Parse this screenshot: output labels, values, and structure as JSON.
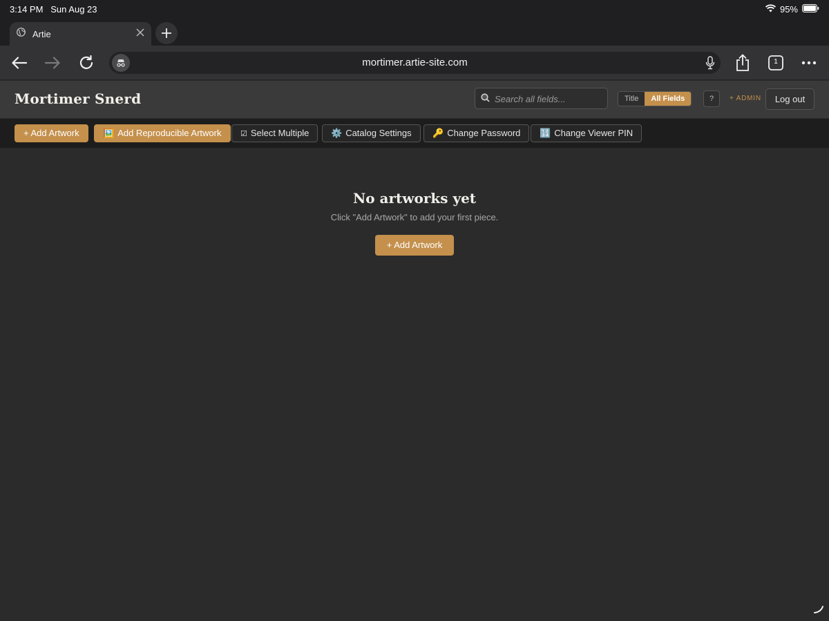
{
  "status": {
    "time": "3:14 PM",
    "date": "Sun Aug 23",
    "battery": "95%"
  },
  "browser": {
    "tab_title": "Artie",
    "url": "mortimer.artie-site.com",
    "tab_count": "1",
    "accent": "#c4904c"
  },
  "header": {
    "site_title": "Mortimer Snerd",
    "search_placeholder": "Search all fields...",
    "scope_options": [
      "Title",
      "All Fields"
    ],
    "scope_selected": "All Fields",
    "help_label": "?",
    "admin_label": "+ ADMIN",
    "logout_label": "Log out"
  },
  "actions": {
    "add_artwork": "+ Add Artwork",
    "add_reproducible": "Add Reproducible Artwork",
    "select_multiple": "Select Multiple",
    "catalog_settings": "Catalog Settings",
    "change_password": "Change Password",
    "change_viewer_pin": "Change Viewer PIN"
  },
  "icons": {
    "add_reproducible": "🖼️",
    "select_multiple": "☑",
    "catalog_settings": "⚙️",
    "change_password": "🔑",
    "change_viewer_pin": "🔢"
  },
  "empty_state": {
    "title": "No artworks yet",
    "subtitle": "Click \"Add Artwork\" to add your first piece.",
    "button": "+ Add Artwork"
  }
}
